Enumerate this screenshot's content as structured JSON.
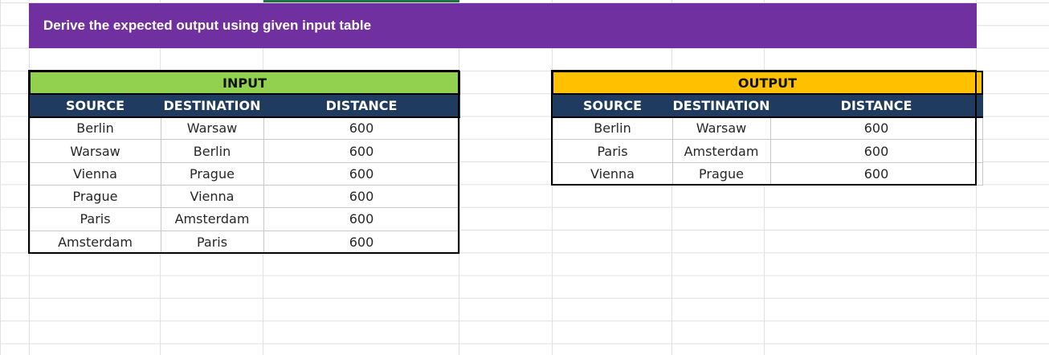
{
  "banner": {
    "text": "Derive the expected output using given input table"
  },
  "input_table": {
    "title": "INPUT",
    "headers": [
      "SOURCE",
      "DESTINATION",
      "DISTANCE"
    ],
    "rows": [
      [
        "Berlin",
        "Warsaw",
        "600"
      ],
      [
        "Warsaw",
        "Berlin",
        "600"
      ],
      [
        "Vienna",
        "Prague",
        "600"
      ],
      [
        "Prague",
        "Vienna",
        "600"
      ],
      [
        "Paris",
        "Amsterdam",
        "600"
      ],
      [
        "Amsterdam",
        "Paris",
        "600"
      ]
    ]
  },
  "output_table": {
    "title": "OUTPUT",
    "headers": [
      "SOURCE",
      "DESTINATION",
      "DISTANCE"
    ],
    "rows": [
      [
        "Berlin",
        "Warsaw",
        "600"
      ],
      [
        "Paris",
        "Amsterdam",
        "600"
      ],
      [
        "Vienna",
        "Prague",
        "600"
      ]
    ]
  },
  "colors": {
    "banner": "#7030a0",
    "input_title": "#92d050",
    "output_title": "#ffc000",
    "header": "#1f3b5f"
  }
}
